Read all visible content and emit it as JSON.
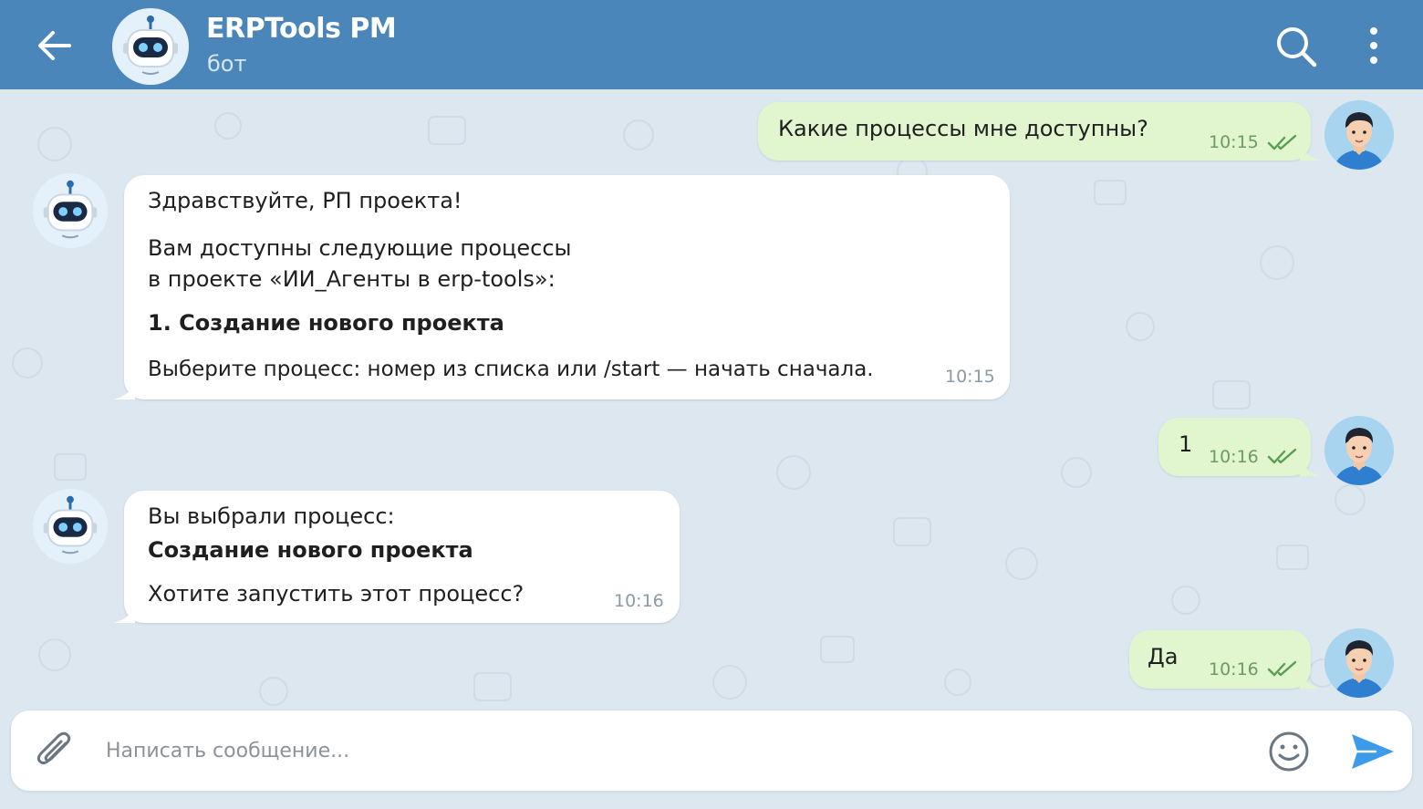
{
  "header": {
    "title": "ERPTools PM",
    "subtitle": "бот",
    "back_icon": "arrow-left-icon",
    "search_icon": "search-icon",
    "menu_icon": "more-vertical-icon",
    "background_color": "#4a86b9"
  },
  "messages": [
    {
      "direction": "outgoing",
      "text": "Какие процессы мне доступны?",
      "time": "10:15",
      "status_icon": "double-check-icon"
    },
    {
      "direction": "incoming",
      "greeting": "Здравствуйте, РП проекта!",
      "line1": "Вам доступны следующие процессы",
      "line2": "в проекте «ИИ_Агенты в erp-tools»:",
      "list_item": "1.  Создание нового проекта",
      "prompt": "Выберите процесс: номер из списка или /start — начать сначала.",
      "time": "10:15"
    },
    {
      "direction": "outgoing",
      "text": "1",
      "time": "10:16",
      "status_icon": "double-check-icon"
    },
    {
      "direction": "incoming",
      "line1": "Вы выбрали процесс:",
      "line2": "Создание нового проекта",
      "question": "Хотите запустить этот процесс?",
      "time": "10:16"
    },
    {
      "direction": "outgoing",
      "text": "Да",
      "time": "10:16",
      "status_icon": "double-check-icon"
    }
  ],
  "composer": {
    "placeholder": "Написать сообщение...",
    "value": "",
    "attach_icon": "paperclip-icon",
    "emoji_icon": "smile-icon",
    "send_icon": "send-icon"
  },
  "colors": {
    "incoming_bubble": "#ffffff",
    "outgoing_bubble": "#e1f5cf",
    "chat_background": "#dce7f0",
    "send_accent": "#3d9be9"
  }
}
